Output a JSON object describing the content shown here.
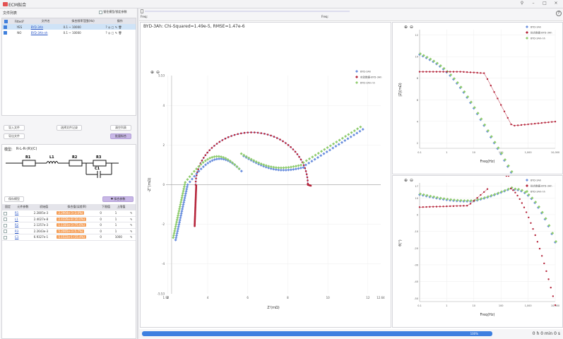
{
  "window": {
    "title": "ECM拟合",
    "pin": "⚲",
    "minimize": "–",
    "maximize": "□",
    "close": "×"
  },
  "left": {
    "file_list_title": "文件列表",
    "lock_option_label": "锁住模型/锁定参数",
    "file_table": {
      "headers": [
        "Fitted?",
        "文件名",
        "拟合频率范围(Hz)",
        "操作"
      ],
      "rows": [
        {
          "fitted": "YES",
          "name": "BYD-3Ah",
          "fmin": "0.1",
          "dash": "~",
          "fmax": "10000",
          "checked": true,
          "selected": true
        },
        {
          "fitted": "NO",
          "name": "BYD-3Ah-nh",
          "fmin": "0.1",
          "dash": "~",
          "fmax": "10000",
          "checked": true,
          "selected": false
        }
      ]
    },
    "buttons": {
      "import": "导入文件",
      "select_history": "选择文件记录",
      "clear_list": "清空列表",
      "export": "导出文件",
      "batch_fit": "批量拟合"
    },
    "model_label": "模型:",
    "model_formula": "R-L-R-(R)(C)",
    "circuit": {
      "r1": "R1",
      "l1": "L1",
      "r2": "R2",
      "r3": "R3",
      "c1": "C1"
    },
    "save_model": "保存模型",
    "fit_button": "♥ 拟合参数",
    "param_table": {
      "headers": [
        "固定",
        "元件参数",
        "初始值",
        "拟合值(误差率)",
        "下限值",
        "上限值"
      ],
      "rows": [
        {
          "name": "R1",
          "init": "2.2805e-3",
          "fit": "2.2904e-3 (3.0%)",
          "low": "0",
          "high": "1"
        },
        {
          "name": "L1",
          "init": "2.4027e-8",
          "fit": "2.4326e-8 (30.0%)",
          "low": "0",
          "high": "1"
        },
        {
          "name": "R2",
          "init": "2.1257e-3",
          "fit": "1.1381e-3 (75.6%)",
          "low": "0",
          "high": "1"
        },
        {
          "name": "R3",
          "init": "2.2643e-3",
          "fit": "5.2065e-3 (5.7%)",
          "low": "0",
          "high": "1"
        },
        {
          "name": "C1",
          "init": "6.9327e-1",
          "fit": "5.1522e-1 (15.4%)",
          "low": "0",
          "high": "1000"
        }
      ]
    }
  },
  "toolbar": {
    "freq_label_1": "Freq:",
    "freq_label_2": "Freq:",
    "help": "?"
  },
  "nyquist": {
    "header": "BYD-3Ah: Chi-Squared=1.49e-5, RMSE=1.47e-6",
    "xlabel": "Z'(mΩ)",
    "ylabel": "-Z''(mΩ)",
    "xticks": [
      "1.92",
      "2",
      "4",
      "6",
      "8",
      "10",
      "12",
      "12.64"
    ],
    "yticks": [
      "5.53",
      "4",
      "2",
      "0",
      "-2",
      "-4",
      "-5.53"
    ],
    "legend": [
      "BYD-3Ah",
      "实验数据-BYD-3Ah",
      "BYD-3Ah-nh"
    ]
  },
  "bode_mag": {
    "xlabel": "Freq(Hz)",
    "ylabel": "|Z|(mΩ)",
    "xticks": [
      "0.1",
      "1",
      "10",
      "100",
      "1,000",
      "10,000"
    ],
    "yticks": [
      "12",
      "10",
      "8",
      "6",
      "4",
      "2"
    ],
    "legend": [
      "BYD-3Ah",
      "拟合数据-BYD-3Ah",
      "BYD-3Ah-nh"
    ]
  },
  "bode_phase": {
    "xlabel": "Freq(Hz)",
    "ylabel": "θ(°)",
    "xticks": [
      "0.1",
      "1",
      "10",
      "100",
      "1,000",
      "10,000"
    ],
    "yticks": [
      "17",
      "10",
      "0",
      "-10",
      "-20",
      "-30",
      "-40",
      "-50"
    ],
    "legend": [
      "BYD-3Ah",
      "拟合数据-BYD-3Ah",
      "BYD-3Ah-nh"
    ]
  },
  "status": {
    "progress_label": "100%",
    "progress": 1.0,
    "elapsed": "0 h 0 min 0 s"
  },
  "colors": {
    "blue": "#6b8fde",
    "red": "#b5243a",
    "green": "#8fcc6e",
    "accent": "#3d7fe0"
  }
}
